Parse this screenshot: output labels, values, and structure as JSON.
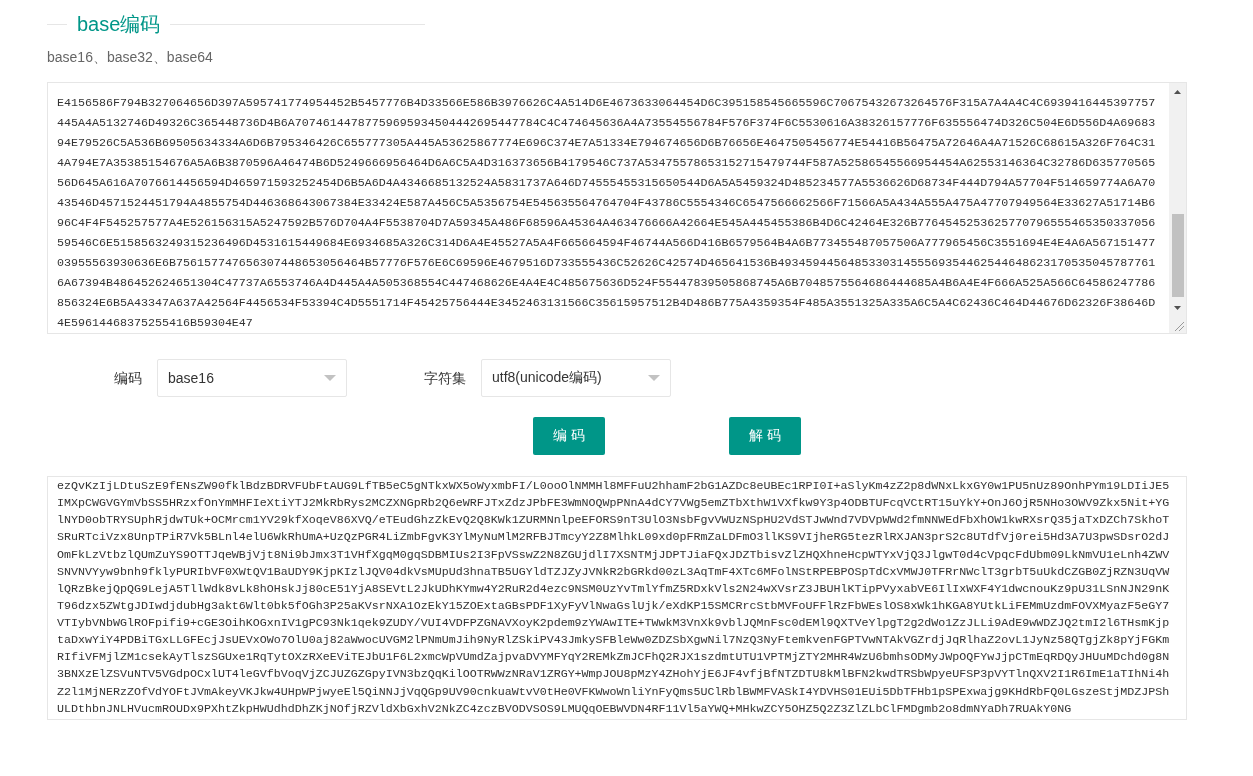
{
  "section": {
    "title": "base编码",
    "subtitle": "base16、base32、base64"
  },
  "hex_text_area": {
    "value": "E4156586F794B327064656D397A595741774954452B5457776B4D33566E586B3976626C4A514D6E4673633064454D6C395158545665596C70675432673264576F315A7A4A4C4C6939416445397757445A4A5132746D49326C365448736D4B6A70746144787759695934504442695447784C4C474645636A4A73554556784F576F374F6C5530616A38326157776F635556474D326C504E6D556D4A6968394E79526C5A536B69505634334A6D6B795346426C655777305A445A53625867774E696C374E7A51334E794674656D6B76656E4647505456774E54416B56475A72646A4A71526C68615A326F764C314A794E7A35385154676A5A6B3870596A46474B6D5249666956464D6A6C5A4D316373656B4179546C737A53475578653152715479744F587A52586545566954454A62553146364C32786D63577056556D645A616A7076614456594D465971593252454D6B5A6D4A4346685132524A5831737A646D74555455315650544D6A5A5459324D485234577A5536626D68734F444D794A57704F514659774A6A7043546D4571524451794A4855754D446368643067384E33424E587A456C5A5356754E545635564764704F43786C5554346C6547566662566F71566A5A434A555A475A47707949564E33627A51714B696C4F4F545257577A4E526156315A5247592B576D704A4F5538704D7A59345A486F68596A45364A463476666A42664E545A445455386B4D6C42464E326B776454525362577079655546535033705659546C6E5158563249315236496D4531615449684E6934685A326C314D6A4E45527A5A4F665664594F46744A566D416B6579564B4A6B773455487057506A777965456C3551694E4E4A6A56715147703955563930636E6B756157747656307448653056464B57776F576E6C69596E4679516D733555436C52626C42574D465641536B4934594456485330314555693544625446486231705350457877616A67394B486452624651304C47737A6553746A4D445A4A505368554C447468626E4A4E4C485675636D524F55447839505868745A6B7048575564686444685A4B6A4E4F666A525A566C64586247786856324E6B5A43347A637A42564F4456534F53394C4D5551714F45425756444E3452463131566C35615957512B4D486B775A4359354F485A3551325A335A6C5A4C62436C464D44676D62326F38646D4E59614468375255416B59304E47"
  },
  "form": {
    "fields": [
      {
        "label": "编码",
        "value": "base16"
      },
      {
        "label": "字符集",
        "value": "utf8(unicode编码)"
      }
    ]
  },
  "buttons": [
    "编 码",
    "解 码"
  ],
  "plain_text_area": {
    "value": "ezQvKzIjLDtuSzE9fENsZW90fklBdzBDRVFUbFtAUG9LfTB5eC5gNTkxWX5oWyxmbFI/L0ooOlNMMHl8MFFuU2hhamF2bG1AZDc8eUBEc1RPI0I+aSlyKm4zZ2p8dWNxLkxGY0w1PU5nUz89OnhPYm19LDIiJE5IMXpCWGVGYmVbSS5HRzxfOnYmMHFIeXtiYTJ2MkRbRys2MCZXNGpRb2Q6eWRFJTxZdzJPbFE3WmNOQWpPNnA4dCY7VWg5emZTbXthW1VXfkw9Y3p4ODBTUFcqVCtRT15uYkY+OnJ6OjR5NHo3OWV9Zkx5Nit+YGlNYD0obTRYSUphRjdwTUk+OCMrcm1YV29kfXoqeV86XVQ/eTEudGhzZkEvQ2Q8KWk1ZURMNnlpeEFORS9nT3UlO3NsbFgvVWUzNSpHU2VdSTJwWnd7VDVpWWd2fmNNWEdFbXhOW1kwRXsrQ35jaTxDZCh7SkhoTSRuRTciVzx8UnpTPiR7Vk5BLnl4elU6WkRhUmA+UzQzPGR4LiZmbFgvK3YlMyNuMlM2RFBJTmcyY2Z8MlhkL09xd0pFRmZaLDFmO3llKS9VIjheRG5tezRlRXJAN3prS2c8UTdfVj0rei5Hd3A7U3pwSDsrO2dJOmFkLzVtbzlQUmZuYS9OTTJqeWBjVjt8Ni9bJmx3T1VHfXgqM0gqSDBMIUs2I3FpVSswZ2N8ZGUjdlI7XSNTMjJDPTJiaFQxJDZTbisvZlZHQXhneHcpWTYxVjQ3JlgwT0d4cVpqcFdUbm09LkNmVU1eLnh4ZWVSNVNVYyw9bnh9fklyPURIbVF0XWtQV1BaUDY9KjpKIzlJQV04dkVsMUpUd3hnaTB5UGYldTZJZyJVNkR2bGRkd00zL3AqTmF4XTc6MFolNStRPEBPOSpTdCxVMWJ0TFRrNWclT3grbT5uUkdCZGB0ZjRZN3UqVWlQRzBkejQpQG9LejA5TllWdk8vLk8hOHskJj80cE51YjA8SEVtL2JkUDhKYmw4Y2RuR2d4ezc9NSM0UzYvTmlYfmZ5RDxkVls2N24wXVsrZ3JBUHlKTipPVyxabVE6IlIxWXF4Y1dwcnouKz9pU31LSnNJN29nKT96dzx5ZWtgJDIwdjdubHg3akt6Wlt0bk5fOGh3P25aKVsrNXA1OzEkY15ZOExtaGBsPDF1XyFyVlNwaGslUjk/eXdKP15SMCRrcStbMVFoUFFlRzFbWEslOS8xWk1hKGA8YUtkLiFEMmUzdmFOVXMyazF5eGY7VTIybVNbWGlROFpifi9+cGE3OihKOGxnIV1gPC93Nk1qek9ZUDY/VUI4VDFPZGNAVXoyK2pdem9zYWAwITE+TWwkM3VnXk9vblJQMnFsc0dEMl9QXTVeYlpgT2g2dWo1ZzJLLi9AdE9wWDZJQ2tmI2l6THsmKjptaDxwYiY4PDBiTGxLLGFEcjJsUEVxOWo7OlU0aj82aWwocUVGM2lPNmUmJih9NyRlZSkiPV43JmkySFBleWw0ZDZSbXgwNil7NzQ3NyFtemkvenFGPTVwNTAkVGZrdjJqRlhaZ2ovL1JyNz58QTgjZk8pYjFGKmRIfiVFMjlZM1csekAyTlszSGUxe1RqTytOXzRXeEViTEJbU1F6L2xmcWpVUmdZajpvaDVYMFYqY2REMkZmJCFhQ2RJX1szdmtUTU1VPTMjZTY2MHR4WzU6bmhsODMyJWpOQFYwJjpCTmEqRDQyJHUuMDchd0g8N3BNXzElZSVuNTV5VGdpOCxlUT4leGVfbVoqVjZCJUZGZGpyIVN3bzQqKilOOTRWWzNRaV1ZRGY+WmpJOU8pMzY4ZHohYjE6JF4vfjBfNTZDTU8kMlBFN2kwdTRSbWpyeUFSP3pVYTlnQXV2I1R6ImE1aTIhNi4hZ2l1MjNERzZOfVdYOFtJVmAkeyVKJkw4UHpWPjwyeEl5QiNNJjVqQGp9UV90cnkuaWtvV0tHe0VFKWwoWnliYnFyQms5UClRblBWMFVASkI4YDVHS01EUi5DbTFHb1pSPExwajg9KHdRbFQ0LGszeStjMDZJPShULDthbnJNLHVucmROUDx9PXhtZkpHWUdhdDhZKjNOfjRZVldXbGxhV2NkZC4zczBVODVSOS9LMUQqOEBWVDN4RF11Vl5aYWQ+MHkwZCY5OHZ5Q2Z3ZlZLbClFMDgmb2o8dmNYaDh7RUAkY0NG"
  }
}
